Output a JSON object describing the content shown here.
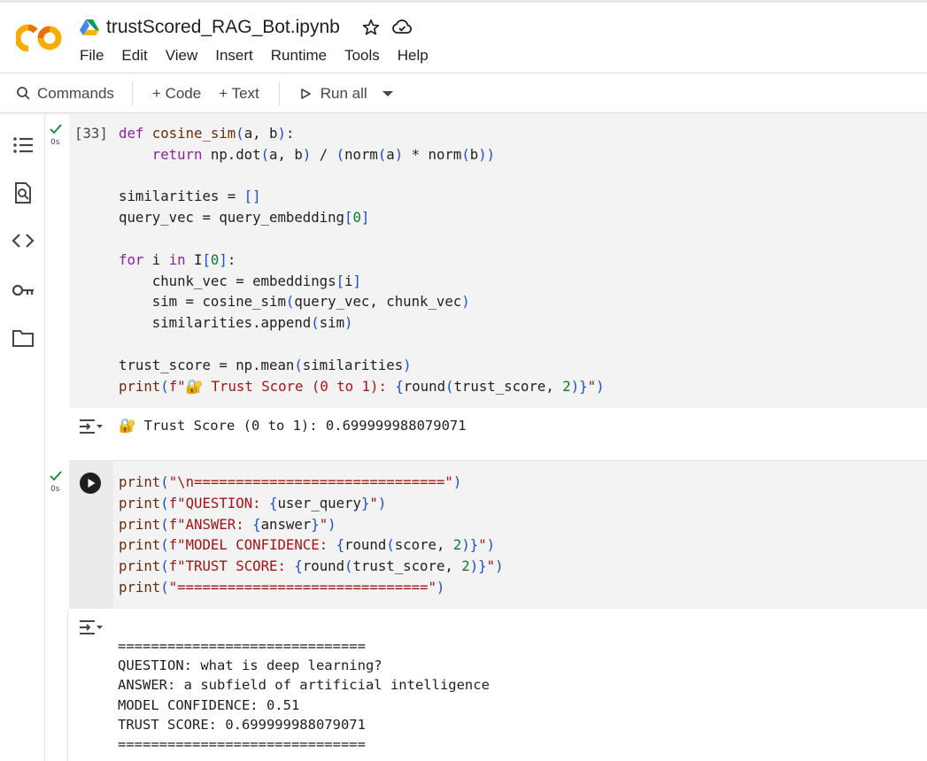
{
  "notebook": {
    "title": "trustScored_RAG_Bot.ipynb",
    "menu": [
      "File",
      "Edit",
      "View",
      "Insert",
      "Runtime",
      "Tools",
      "Help"
    ]
  },
  "toolbar": {
    "commands_label": "Commands",
    "code_label": "+ Code",
    "text_label": "+ Text",
    "run_all_label": "Run all"
  },
  "cells": [
    {
      "exec_count": "[33]",
      "status_time": "0s",
      "output_lines": [
        "🔐 Trust Score (0 to 1): 0.699999988079071"
      ]
    },
    {
      "exec_count": "",
      "status_time": "0s",
      "output_lines": [
        "==============================",
        "QUESTION: what is deep learning?",
        "ANSWER: a subfield of artificial intelligence",
        "MODEL CONFIDENCE: 0.51",
        "TRUST SCORE: 0.699999988079071",
        "=============================="
      ]
    }
  ],
  "code_cell_1": [
    "def cosine_sim(a, b):",
    "    return np.dot(a, b) / (norm(a) * norm(b))",
    "",
    "similarities = []",
    "query_vec = query_embedding[0]",
    "",
    "for i in I[0]:",
    "    chunk_vec = embeddings[i]",
    "    sim = cosine_sim(query_vec, chunk_vec)",
    "    similarities.append(sim)",
    "",
    "trust_score = np.mean(similarities)",
    "print(f\"🔐 Trust Score (0 to 1): {round(trust_score, 2)}\")"
  ],
  "code_cell_2": [
    "print(\"\\n==============================\")",
    "print(f\"QUESTION: {user_query}\")",
    "print(f\"ANSWER: {answer}\")",
    "print(f\"MODEL CONFIDENCE: {round(score, 2)}\")",
    "print(f\"TRUST SCORE: {round(trust_score, 2)}\")",
    "print(\"==============================\")"
  ],
  "colors": {
    "keyword": "#8b1fa9",
    "string": "#a31515",
    "number": "#0b7a2e",
    "bracket": "#1a4cd8",
    "cell_bg": "#f3f3f3"
  },
  "icons": {
    "logo": "colab-logo",
    "rail": [
      "table-of-contents-icon",
      "find-icon",
      "code-snippets-icon",
      "secrets-key-icon",
      "files-folder-icon"
    ]
  }
}
